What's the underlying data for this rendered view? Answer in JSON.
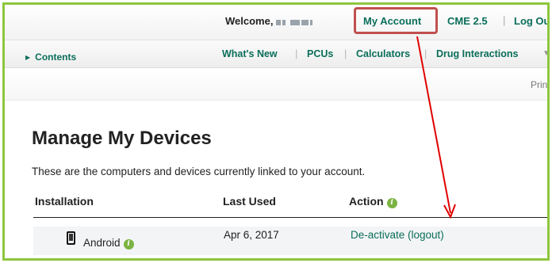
{
  "header": {
    "welcome_label": "Welcome,",
    "my_account": "My Account",
    "cme": "CME 2.5",
    "separator": "|",
    "logout": "Log Out"
  },
  "nav": {
    "contents": "Contents",
    "items": [
      {
        "label": "What's New"
      },
      {
        "label": "PCUs"
      },
      {
        "label": "Calculators"
      },
      {
        "label": "Drug Interactions"
      }
    ],
    "more_caret": "▼"
  },
  "print_label": "Print",
  "page": {
    "title": "Manage My Devices",
    "description": "These are the computers and devices currently linked to your account."
  },
  "table": {
    "headers": [
      "Installation",
      "Last Used",
      "Action"
    ],
    "rows": [
      {
        "device": "Android",
        "last_used": "Apr 6, 2017",
        "action": "De-activate (logout)"
      }
    ]
  },
  "colors": {
    "brand_green": "#8ec63f",
    "link_teal": "#0a6e5a",
    "highlight_red": "#c0504d",
    "arrow_red": "#e00000"
  }
}
